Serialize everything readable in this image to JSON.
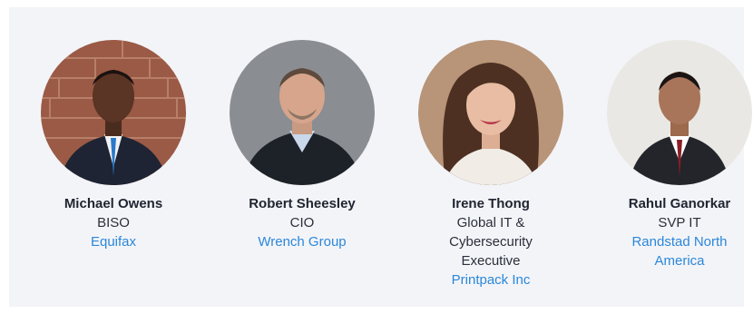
{
  "speakers": [
    {
      "name": "Michael Owens",
      "title": "BISO",
      "company": "Equifax",
      "photo_icon": "person-photo"
    },
    {
      "name": "Robert Sheesley",
      "title": "CIO",
      "company": "Wrench Group",
      "photo_icon": "person-photo"
    },
    {
      "name": "Irene Thong",
      "title": "Global IT & Cybersecurity Executive",
      "company": "Printpack Inc",
      "photo_icon": "person-photo"
    },
    {
      "name": "Rahul Ganorkar",
      "title": "SVP IT",
      "company": "Randstad North America",
      "photo_icon": "person-photo"
    }
  ],
  "colors": {
    "panel_bg": "#f3f4f8",
    "link": "#2b87da",
    "text": "#1f2430"
  }
}
